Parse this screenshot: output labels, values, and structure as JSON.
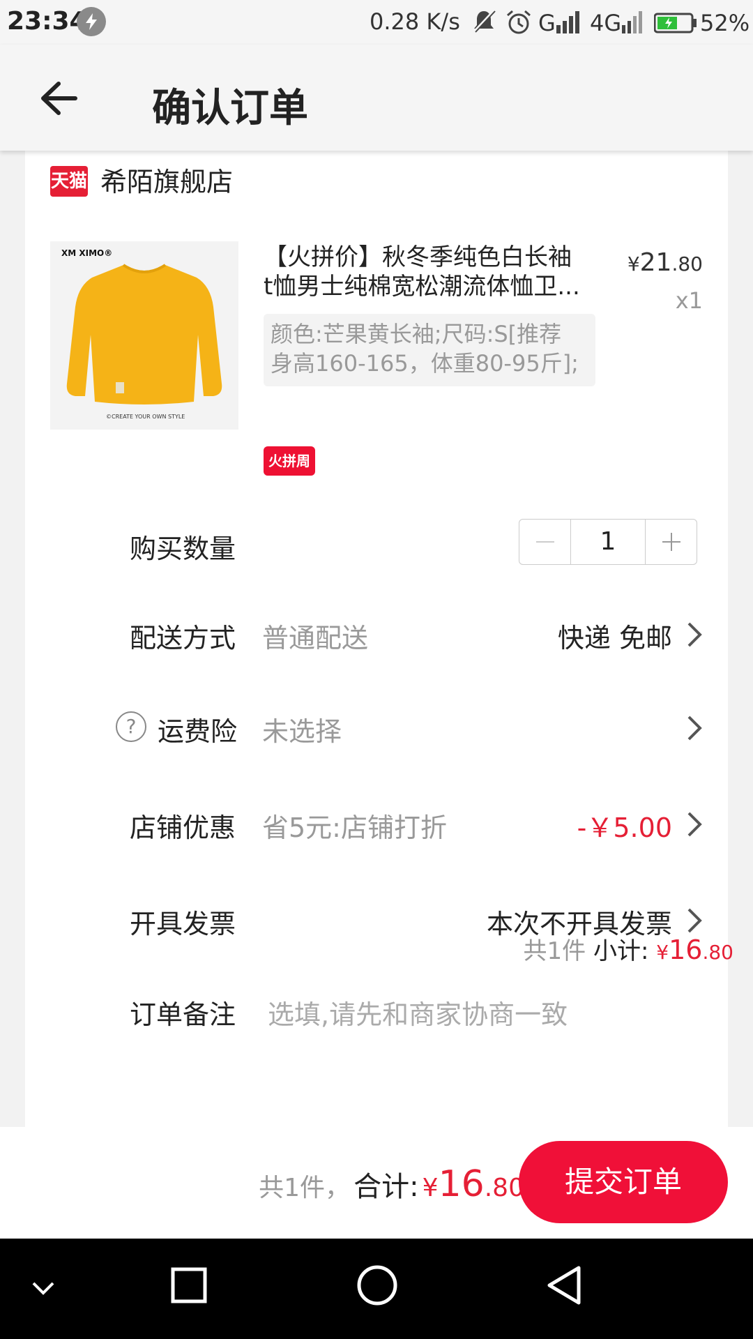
{
  "status_bar": {
    "time": "23:34",
    "net_speed": "0.28 K/s",
    "battery": "52%"
  },
  "header": {
    "title": "确认订单"
  },
  "shop": {
    "badge": "天猫",
    "name": "希陌旗舰店"
  },
  "product": {
    "brand": "XM XIMO®",
    "slogan": "©CREATE YOUR OWN STYLE",
    "title_line1": "【火拼价】秋冬季纯色白长袖",
    "title_line2": "t恤男士纯棉宽松潮流体恤卫...",
    "sku_line1": "颜色:芒果黄长袖;尺码:S[推荐",
    "sku_line2": "身高160-165，体重80-95斤];",
    "price_currency": "¥",
    "price_int": "21",
    "price_dec": ".80",
    "quantity_label": "x1",
    "promo_tag": "火拼周"
  },
  "rows": {
    "quantity": {
      "label": "购买数量",
      "value": "1"
    },
    "delivery": {
      "label": "配送方式",
      "value": "普通配送",
      "right": "快递 免邮"
    },
    "insurance": {
      "label": "运费险",
      "value": "未选择",
      "help": "?"
    },
    "discount": {
      "label": "店铺优惠",
      "value": "省5元:店铺打折",
      "right": "-￥5.00"
    },
    "invoice": {
      "label": "开具发票",
      "right": "本次不开具发票"
    },
    "note": {
      "label": "订单备注",
      "placeholder": "选填,请先和商家协商一致"
    }
  },
  "subtotal": {
    "count": "共1件",
    "label": "小计:",
    "currency": "¥",
    "int": "16",
    "dec": ".80"
  },
  "bottom_bar": {
    "count": "共1件，",
    "label": "合计:",
    "currency": "¥",
    "int": "16",
    "dec": ".80",
    "submit": "提交订单"
  },
  "colors": {
    "accent": "#f01038",
    "price_red": "#e51f35",
    "product_yellow": "#f5b317"
  }
}
